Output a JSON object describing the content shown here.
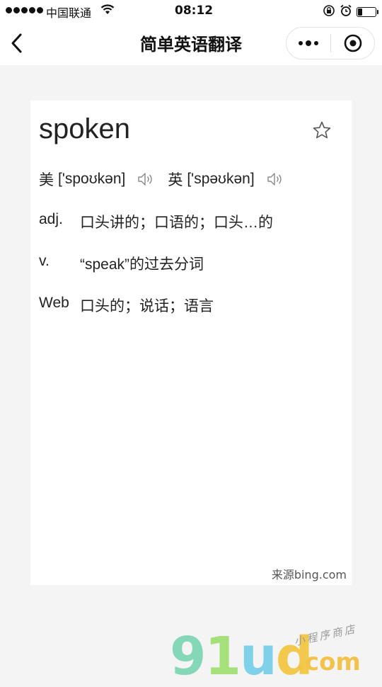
{
  "status_bar": {
    "carrier": "中国联通",
    "time": "08:12"
  },
  "nav": {
    "title": "简单英语翻译"
  },
  "entry": {
    "word": "spoken",
    "us_label": "美",
    "us_phonetic": "['spoʊkən]",
    "uk_label": "英",
    "uk_phonetic": "['spəʊkən]",
    "definitions": [
      {
        "pos": "adj.",
        "meaning": "口头讲的；口语的；口头…的"
      },
      {
        "pos": "v.",
        "meaning": "“speak”的过去分词"
      },
      {
        "pos": "Web",
        "meaning": "口头的；说话；语言"
      }
    ],
    "source": "来源bing.com"
  },
  "watermark": {
    "logo": "91ud",
    "domain": ".com",
    "tagline": "小程序商店"
  },
  "colors": {
    "background": "#f4f4f4",
    "card": "#ffffff",
    "text": "#222222"
  }
}
